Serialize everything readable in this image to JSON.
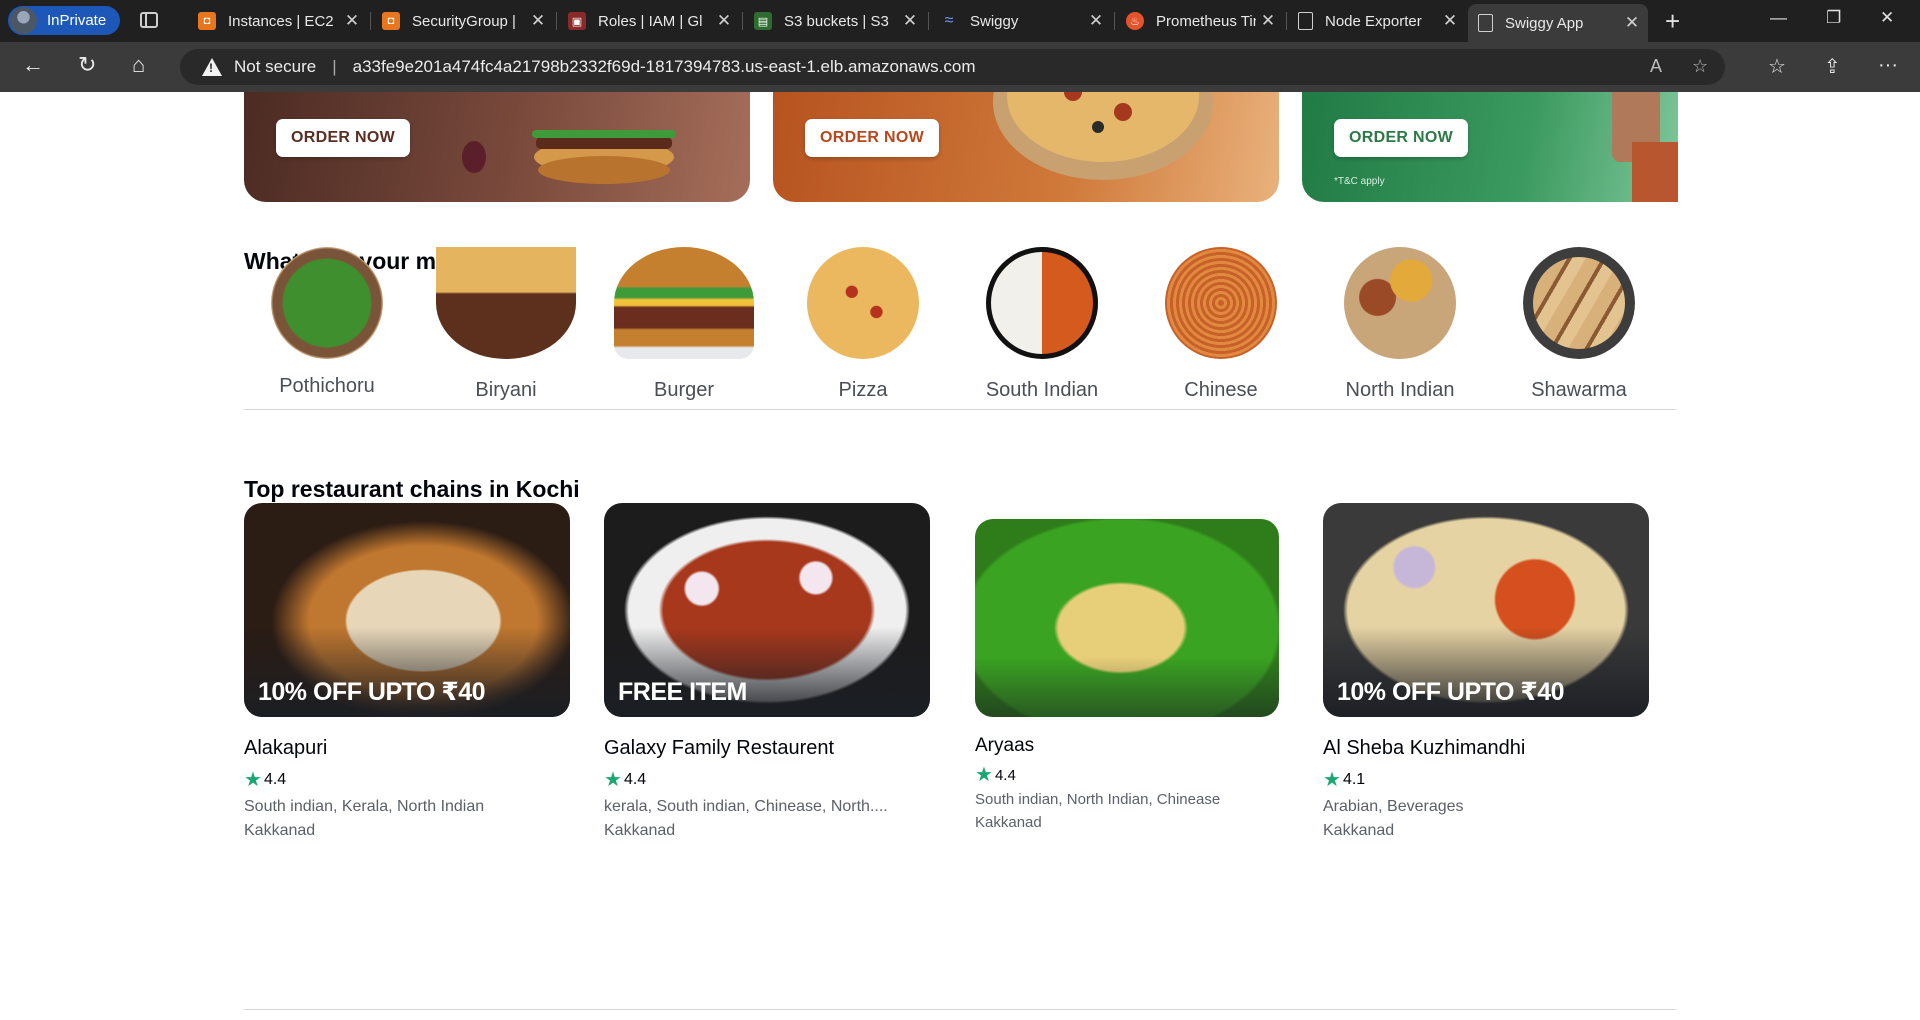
{
  "browser": {
    "profile_label": "InPrivate",
    "tabs": [
      {
        "title": "Instances | EC2",
        "color": "#e8761f",
        "icon": "ec2-icon"
      },
      {
        "title": "SecurityGroup |",
        "color": "#e8761f",
        "icon": "ec2-icon"
      },
      {
        "title": "Roles | IAM | Gl",
        "color": "#c23b3b",
        "icon": "iam-icon"
      },
      {
        "title": "S3 buckets | S3",
        "color": "#3c8c3c",
        "icon": "s3-icon"
      },
      {
        "title": "Swiggy",
        "color": "#4a7bd6",
        "icon": "swiggy-icon"
      },
      {
        "title": "Prometheus Tin",
        "color": "#e6522c",
        "icon": "prometheus-icon"
      },
      {
        "title": "Node Exporter",
        "color": "#cfcfcf",
        "icon": "page-icon"
      },
      {
        "title": "Swiggy App",
        "color": "#cfcfcf",
        "icon": "page-icon"
      }
    ],
    "security_label": "Not secure",
    "url": "a33fe9e201a474fc4a21798b2332f69d-1817394783.us-east-1.elb.amazonaws.com"
  },
  "banners": [
    {
      "button": "ORDER NOW",
      "button_color": "#5a2f22",
      "bg": "#6b4336"
    },
    {
      "button": "ORDER NOW",
      "button_color": "#b9471b",
      "bg": "#c5642b"
    },
    {
      "button": "ORDER NOW",
      "button_color": "#2d7a47",
      "bg": "#2f8a54",
      "note": "*T&C apply"
    }
  ],
  "mind_section": {
    "title": "What’s on your mind Today?",
    "categories": [
      {
        "label": "Pothichoru"
      },
      {
        "label": "Biryani"
      },
      {
        "label": "Burger"
      },
      {
        "label": "Pizza"
      },
      {
        "label": "South Indian"
      },
      {
        "label": "Chinese"
      },
      {
        "label": "North Indian"
      },
      {
        "label": "Shawarma"
      }
    ]
  },
  "chains_section": {
    "title": "Top restaurant chains in Kochi",
    "restaurants": [
      {
        "name": "Alakapuri",
        "offer": "10% OFF UPTO ₹40",
        "rating": "4.4",
        "cuisines": "South indian, Kerala, North Indian",
        "area": "Kakkanad"
      },
      {
        "name": "Galaxy Family Restaurent",
        "offer": "FREE ITEM",
        "rating": "4.4",
        "cuisines": "kerala, South indian, Chinease, North....",
        "area": "Kakkanad"
      },
      {
        "name": "Aryaas",
        "offer": "",
        "rating": "4.4",
        "cuisines": "South indian, North Indian, Chinease",
        "area": "Kakkanad"
      },
      {
        "name": "Al Sheba Kuzhimandhi",
        "offer": "10% OFF UPTO ₹40",
        "rating": "4.1",
        "cuisines": "Arabian, Beverages",
        "area": "Kakkanad"
      }
    ]
  }
}
